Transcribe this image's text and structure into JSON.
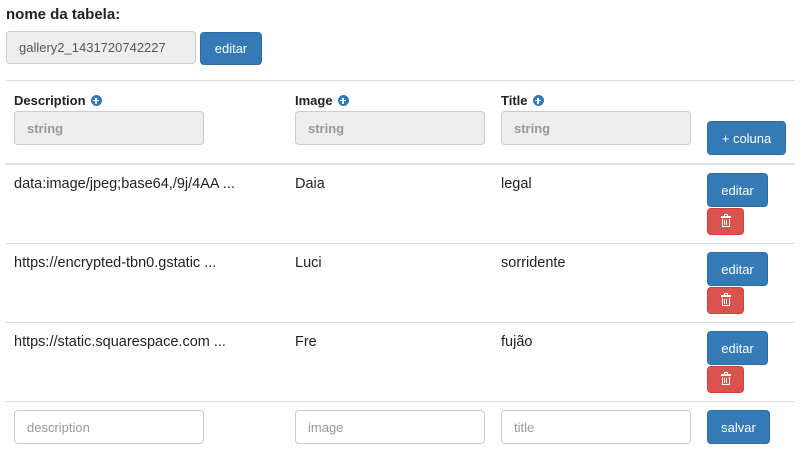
{
  "table": {
    "name_label": "nome da tabela:",
    "name_value": "gallery2_1431720742227",
    "edit_button": "editar"
  },
  "columns": [
    {
      "name": "Description",
      "type": "string"
    },
    {
      "name": "Image",
      "type": "string"
    },
    {
      "name": "Title",
      "type": "string"
    }
  ],
  "add_column_button": "+ coluna",
  "rows": [
    {
      "description": "data:image/jpeg;base64,/9j/4AA ...",
      "image": "Daia",
      "title": "legal",
      "edit_label": "editar"
    },
    {
      "description": "https://encrypted-tbn0.gstatic ...",
      "image": "Luci",
      "title": "sorridente",
      "edit_label": "editar"
    },
    {
      "description": "https://static.squarespace.com ...",
      "image": "Fre",
      "title": "fujão",
      "edit_label": "editar"
    }
  ],
  "new_row": {
    "description_placeholder": "description",
    "image_placeholder": "image",
    "title_placeholder": "title",
    "save_button": "salvar"
  },
  "colors": {
    "primary": "#337ab7",
    "danger": "#d9534f"
  },
  "icons": {
    "column_add": "plus-circle-icon",
    "row_delete": "trash-icon"
  }
}
